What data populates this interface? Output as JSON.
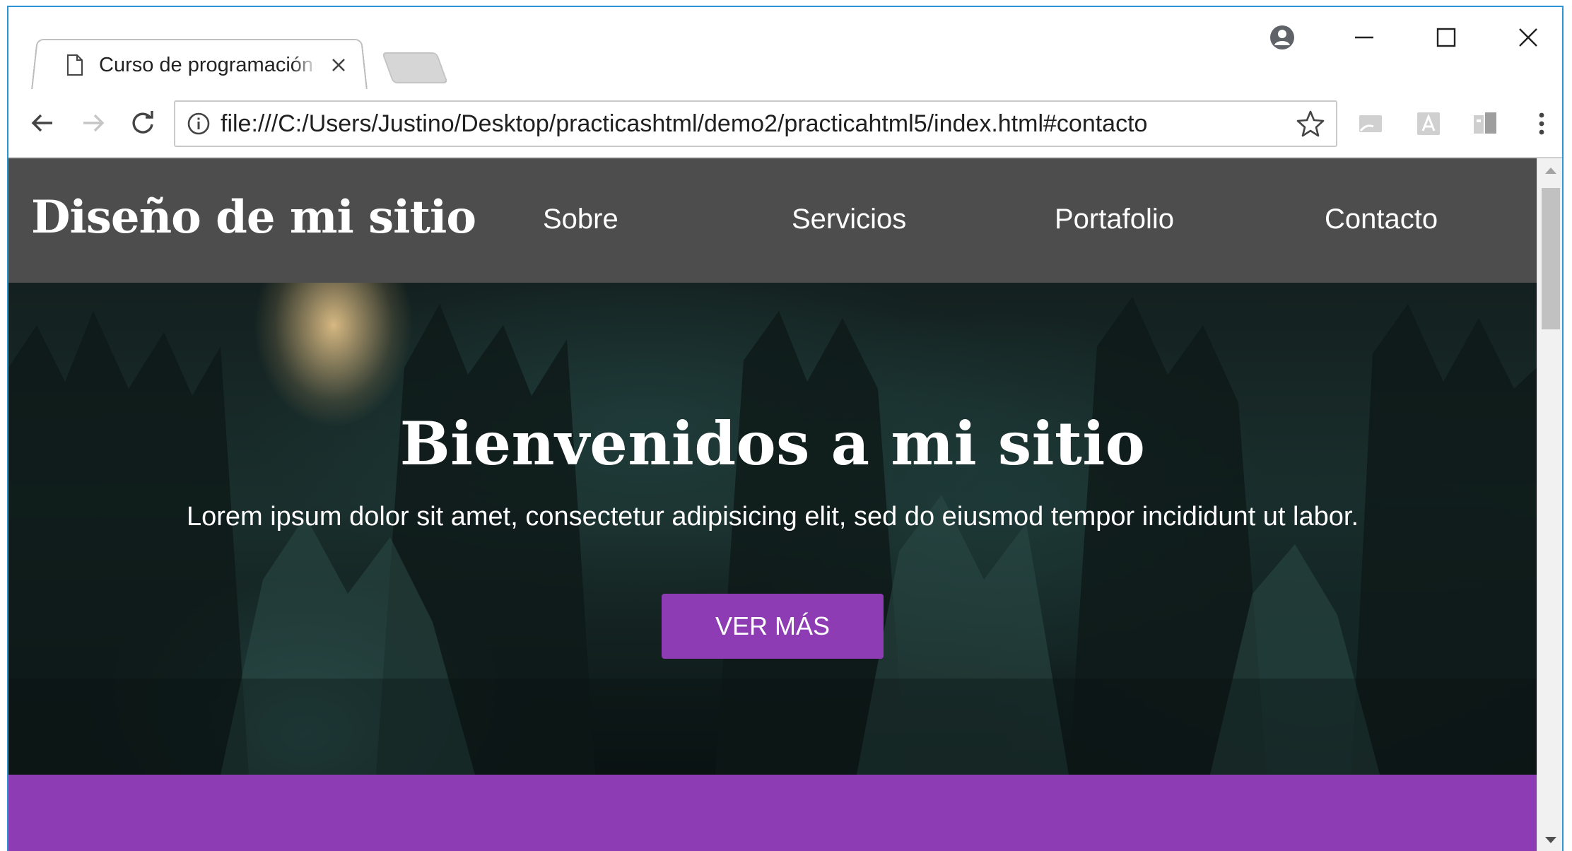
{
  "browser": {
    "tab_title": "Curso de programación web",
    "url": "file:///C:/Users/Justino/Desktop/practicashtml/demo2/practicahtml5/index.html#contacto"
  },
  "site": {
    "brand": "Diseño de mi sitio",
    "nav": [
      "Sobre",
      "Servicios",
      "Portafolio",
      "Contacto"
    ],
    "hero": {
      "title": "Bienvenidos a mi sitio",
      "text": "Lorem ipsum dolor sit amet, consectetur adipisicing elit, sed do eiusmod tempor incididunt ut labor.",
      "button": "VER MÁS"
    }
  },
  "colors": {
    "header_bg": "#4d4d4d",
    "accent_purple": "#8e3cb4",
    "window_border": "#2b95d6"
  },
  "icons": {
    "tab": "page-icon",
    "tab_close": "close-icon",
    "profile": "profile-icon",
    "minimize": "minimize-icon",
    "maximize": "maximize-icon",
    "close": "close-icon",
    "back": "back-arrow-icon",
    "forward": "forward-arrow-icon",
    "reload": "reload-icon",
    "info": "info-icon",
    "bookmark": "star-icon",
    "menu": "kebab-menu-icon"
  }
}
